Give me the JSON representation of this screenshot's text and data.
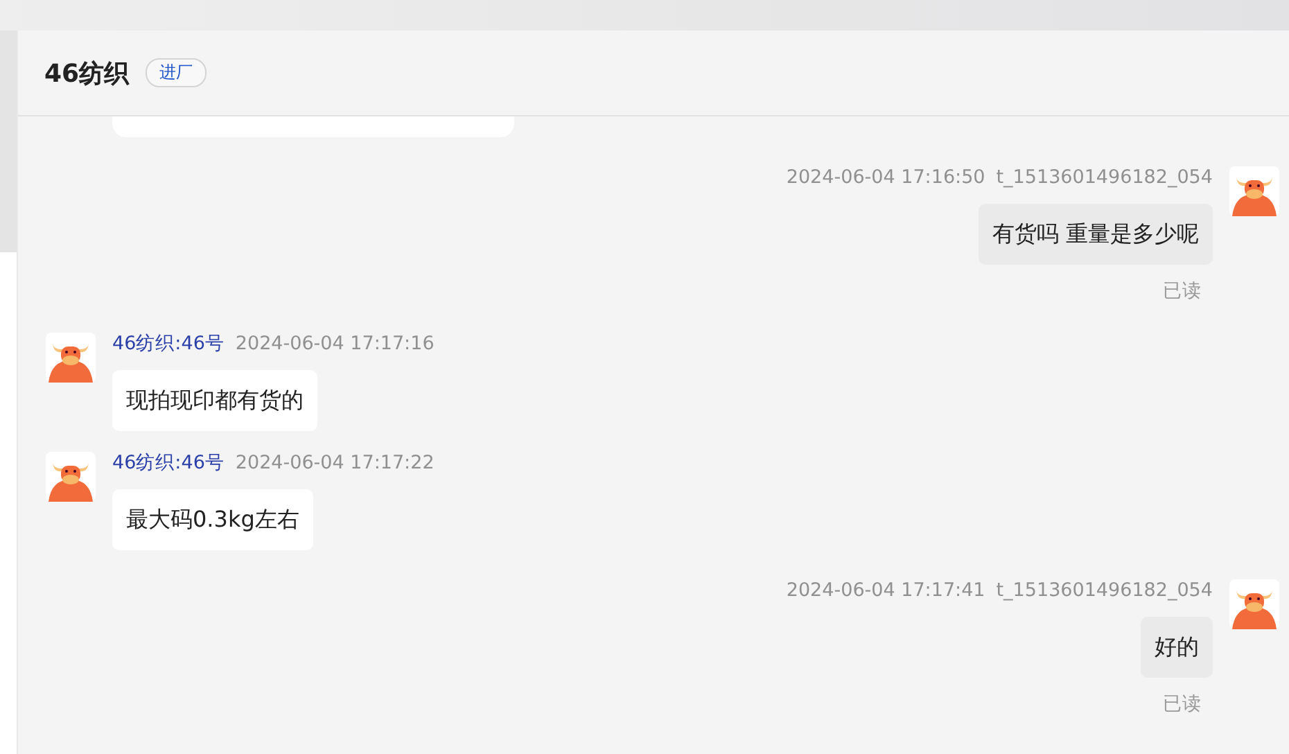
{
  "header": {
    "title": "46纺织",
    "badge": "进厂"
  },
  "messages": [
    {
      "kind": "sent",
      "time": "2024-06-04 17:16:50",
      "sender": "t_1513601496182_054",
      "text": "有货吗 重量是多少呢",
      "status": "已读"
    },
    {
      "kind": "received",
      "sender": "46纺织:46号",
      "time": "2024-06-04 17:17:16",
      "text": "现拍现印都有货的"
    },
    {
      "kind": "received",
      "sender": "46纺织:46号",
      "time": "2024-06-04 17:17:22",
      "text": "最大码0.3kg左右"
    },
    {
      "kind": "sent",
      "time": "2024-06-04 17:17:41",
      "sender": "t_1513601496182_054",
      "text": "好的",
      "status": "已读"
    }
  ]
}
